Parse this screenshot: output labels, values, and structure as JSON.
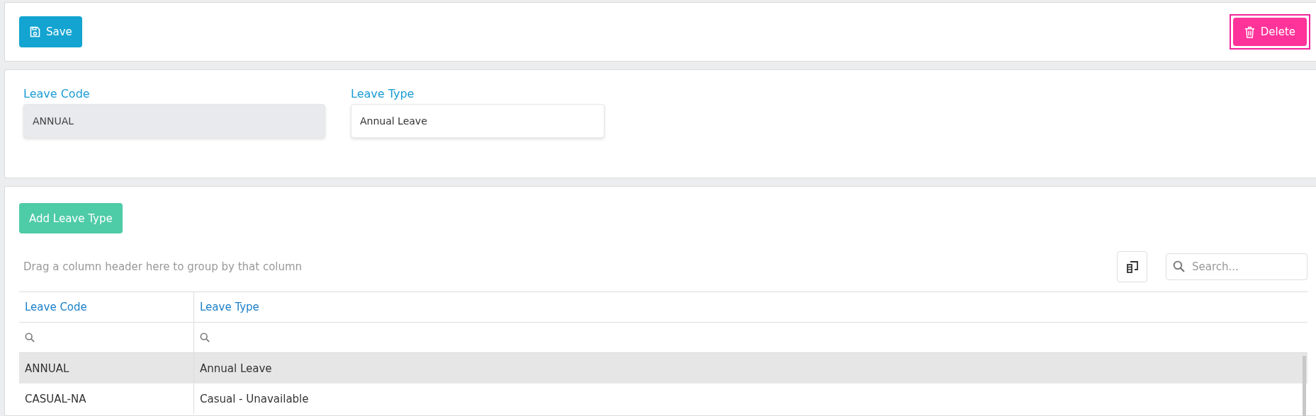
{
  "toolbar": {
    "save_label": "Save",
    "delete_label": "Delete",
    "delete_focused": true
  },
  "form": {
    "fields": [
      {
        "label": "Leave Code",
        "value": "ANNUAL",
        "disabled": true
      },
      {
        "label": "Leave Type",
        "value": "Annual Leave",
        "disabled": false
      }
    ]
  },
  "grid": {
    "add_label": "Add Leave Type",
    "group_panel": "Drag a column header here to group by that column",
    "search": {
      "placeholder": "Search..."
    },
    "columns": [
      "Leave Code",
      "Leave Type"
    ],
    "rows": [
      {
        "cells": [
          "ANNUAL",
          "Annual Leave"
        ],
        "selected": true
      },
      {
        "cells": [
          "CASUAL-NA",
          "Casual - Unavailable"
        ],
        "selected": false
      }
    ]
  }
}
